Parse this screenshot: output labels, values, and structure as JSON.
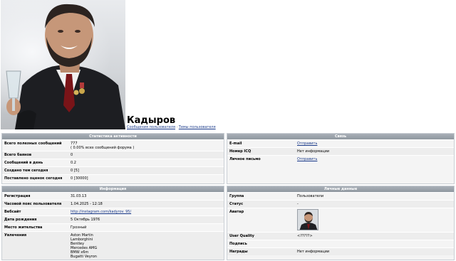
{
  "profile": {
    "name": "Кадыров",
    "subnav": [
      "Сообщения пользователя",
      "Темы пользователя"
    ]
  },
  "activity": {
    "title": "Статистика активности",
    "rows": [
      {
        "label": "Всего полезных сообщений",
        "value": "777",
        "note": "( 0.00% всех сообщений форума )"
      },
      {
        "label": "Всего баянов",
        "value": "0"
      },
      {
        "label": "Сообщений в день",
        "value": "0.2"
      },
      {
        "label": "Создано тем сегодня",
        "value": "0 [5]"
      },
      {
        "label": "Поставлено оценок сегодня",
        "value": "0 [30000]"
      }
    ]
  },
  "contact": {
    "title": "Связь",
    "rows": [
      {
        "label": "E-mail",
        "value": "Отправить"
      },
      {
        "label": "Номер ICQ",
        "value": "Нет информации"
      },
      {
        "label": "Личное письмо",
        "value": "Отправить"
      }
    ]
  },
  "info": {
    "title": "Информация",
    "rows": [
      {
        "label": "Регистрация",
        "value": "31.03.13"
      },
      {
        "label": "Часовой пояс пользователя",
        "value": "1.04.2025 - 12:18"
      },
      {
        "label": "Вебсайт",
        "value": "http://instagram.com/kadyrov_95/"
      },
      {
        "label": "Дата рождения",
        "value": "5 Октябрь 1976"
      },
      {
        "label": "Место жительства",
        "value": "Грозный"
      }
    ],
    "hobbies_label": "Увлечения",
    "hobbies": [
      "Aston Martin",
      "Lamborghini",
      "Bentley",
      "Mercedes AMG",
      "BMW x6m",
      "Bugatti Veyron"
    ]
  },
  "personal": {
    "title": "Личные данные",
    "rows": [
      {
        "label": "Группа",
        "value": "Пользователи"
      },
      {
        "label": "Статус",
        "value": "-"
      },
      {
        "label": "Аватар",
        "value": ""
      },
      {
        "label": "User Quality",
        "value": "<?????>"
      },
      {
        "label": "Подпись",
        "value": ""
      },
      {
        "label": "Награды",
        "value": "Нет информации"
      }
    ]
  },
  "colors": {
    "header": "#8f979f",
    "link": "#1a3a8a"
  }
}
